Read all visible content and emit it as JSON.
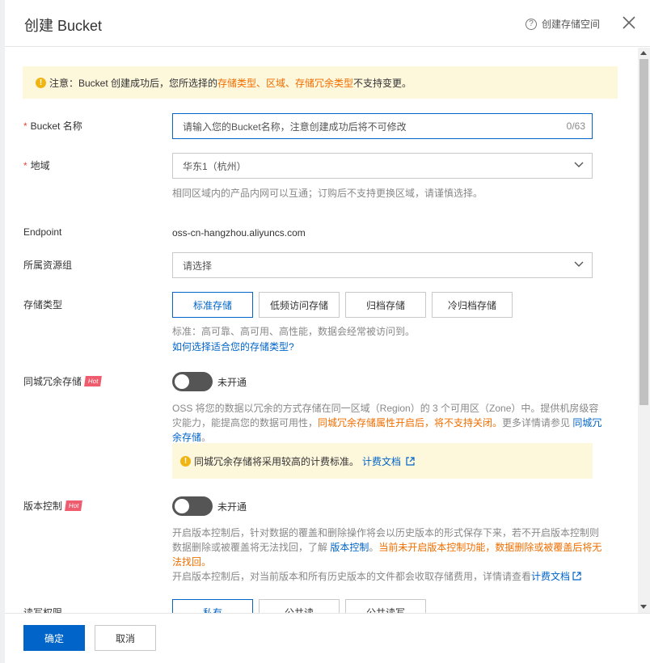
{
  "header": {
    "title": "创建 Bucket",
    "help_label": "创建存储空间"
  },
  "notice": {
    "prefix": "注意：Bucket 创建成功后，您所选择的 ",
    "highlight": "存储类型、区域、存储冗余类型",
    "suffix": " 不支持变更。"
  },
  "bucket_name": {
    "label": "Bucket 名称",
    "placeholder": "请输入您的Bucket名称，注意创建成功后将不可修改",
    "count": "0/63"
  },
  "region": {
    "label": "地域",
    "value": "华东1（杭州）",
    "hint": "相同区域内的产品内网可以互通；订购后不支持更换区域，请谨慎选择。"
  },
  "endpoint": {
    "label": "Endpoint",
    "value": "oss-cn-hangzhou.aliyuncs.com"
  },
  "resource_group": {
    "label": "所属资源组",
    "value": "请选择"
  },
  "storage_class": {
    "label": "存储类型",
    "options": [
      "标准存储",
      "低频访问存储",
      "归档存储",
      "冷归档存储"
    ],
    "selected": "标准存储",
    "hint": "标准：高可靠、高可用、高性能，数据会经常被访问到。",
    "link": "如何选择适合您的存储类型?"
  },
  "zone_redundancy": {
    "label": "同城冗余存储",
    "badge": "Hot",
    "status": "未开通",
    "desc_1": "OSS 将您的数据以冗余的方式存储在同一区域（Region）的 3 个可用区（Zone）中。提供机房级容灾能力，能提高您的数据可用性，",
    "desc_warn": "同城冗余存储属性开启后，将不支持关闭。",
    "desc_2": "更多详情请参见 ",
    "desc_link": "同城冗余存储",
    "desc_end": "。",
    "notice_text": "同城冗余存储将采用较高的计费标准。",
    "notice_link": "计费文档"
  },
  "versioning": {
    "label": "版本控制",
    "badge": "Hot",
    "status": "未开通",
    "desc_1": "开启版本控制后，针对数据的覆盖和删除操作将会以历史版本的形式保存下来，若不开启版本控制则数据删除或被覆盖将无法找回，了解 ",
    "desc_link": "版本控制",
    "desc_sep": "。",
    "desc_warn": "当前未开启版本控制功能，数据删除或被覆盖后将无法找回。",
    "desc_3": "开启版本控制后，对当前版本和所有历史版本的文件都会收取存储费用，详情请查看",
    "desc_3_link": "计费文档"
  },
  "acl": {
    "label": "读写权限",
    "options": [
      "私有",
      "公共读",
      "公共读写"
    ]
  },
  "footer": {
    "ok": "确定",
    "cancel": "取消"
  },
  "colors": {
    "primary": "#0064c8",
    "warning": "#f06e00",
    "notice_bg": "#fdf7dc",
    "hot_badge": "#ee5c6e"
  }
}
